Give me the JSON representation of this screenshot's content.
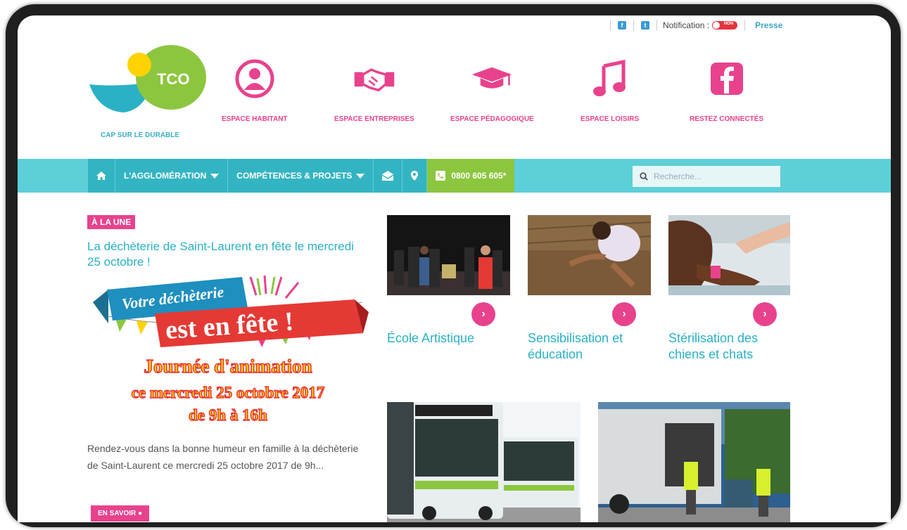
{
  "topbar": {
    "facebook_icon": "f",
    "twitter_icon": "t",
    "notification_label": "Notification :",
    "notification_state": "NON",
    "presse": "Presse"
  },
  "logo": {
    "text": "TCO",
    "tagline": "CAP SUR LE DURABLE"
  },
  "espaces": [
    {
      "label": "ESPACE HABITANT",
      "icon": "user-circle-icon"
    },
    {
      "label": "ESPACE ENTREPRISES",
      "icon": "handshake-icon"
    },
    {
      "label": "ESPACE PÉDAGOGIQUE",
      "icon": "graduation-cap-icon"
    },
    {
      "label": "ESPACE LOISIRS",
      "icon": "music-note-icon"
    },
    {
      "label": "RESTEZ CONNECTÉS",
      "icon": "facebook-icon"
    }
  ],
  "nav": {
    "home_icon": "home-icon",
    "agglomeration": "L'AGGLOMÉRATION",
    "competences": "COMPÉTENCES & PROJETS",
    "mail_icon": "envelope-icon",
    "location_icon": "map-pin-icon",
    "phone": "0800 605 605*",
    "search_placeholder": "Recherche..."
  },
  "feature": {
    "badge": "À LA UNE",
    "headline": "La déchèterie de Saint-Laurent en fête le mercredi 25 octobre !",
    "banner_line1": "Votre déchèterie",
    "banner_line2": "est en fête !",
    "promo_line1": "Journée d'animation",
    "promo_line2": "ce mercredi 25 octobre 2017",
    "promo_line3": "de 9h à 16h",
    "description": "Rendez-vous dans la bonne humeur en famille à la déchèterie de Saint-Laurent ce mercredi 25 octobre 2017 de 9h...",
    "more": "EN SAVOIR"
  },
  "cards": [
    {
      "title": "École Artistique"
    },
    {
      "title": "Sensibilisation et éducation"
    },
    {
      "title": "Stérilisation des chiens et chats"
    }
  ],
  "colors": {
    "pink": "#e8428d",
    "teal": "#33b4c2",
    "nav_bg": "#5dcfd8",
    "green": "#8cc63f"
  }
}
